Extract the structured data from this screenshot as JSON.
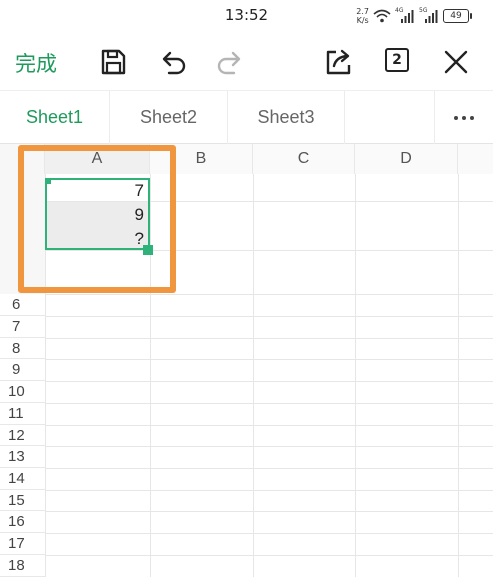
{
  "status_bar": {
    "time": "13:52",
    "net_speed_value": "2.7",
    "net_speed_unit": "K/s",
    "sim1_tag": "4G",
    "sim2_tag": "5G",
    "battery": "49"
  },
  "toolbar": {
    "done_label": "完成",
    "window_count": "2"
  },
  "sheet_tabs": [
    {
      "label": "Sheet1",
      "active": true
    },
    {
      "label": "Sheet2",
      "active": false
    },
    {
      "label": "Sheet3",
      "active": false
    }
  ],
  "grid": {
    "columns": [
      "A",
      "B",
      "C",
      "D"
    ],
    "rows": [
      "6",
      "7",
      "8",
      "9",
      "10",
      "11",
      "12",
      "13",
      "14",
      "15",
      "16",
      "17",
      "18"
    ],
    "cells": [
      {
        "col": "A",
        "value": "7"
      },
      {
        "col": "A",
        "value": "9"
      },
      {
        "col": "A",
        "value": "?"
      }
    ]
  },
  "colors": {
    "accent": "#1e9a5b",
    "selection_border": "#2fb27a",
    "highlight_box": "#f0963f"
  },
  "icons": [
    "save-icon",
    "undo-icon",
    "redo-icon",
    "share-icon",
    "close-icon",
    "more-icon"
  ]
}
